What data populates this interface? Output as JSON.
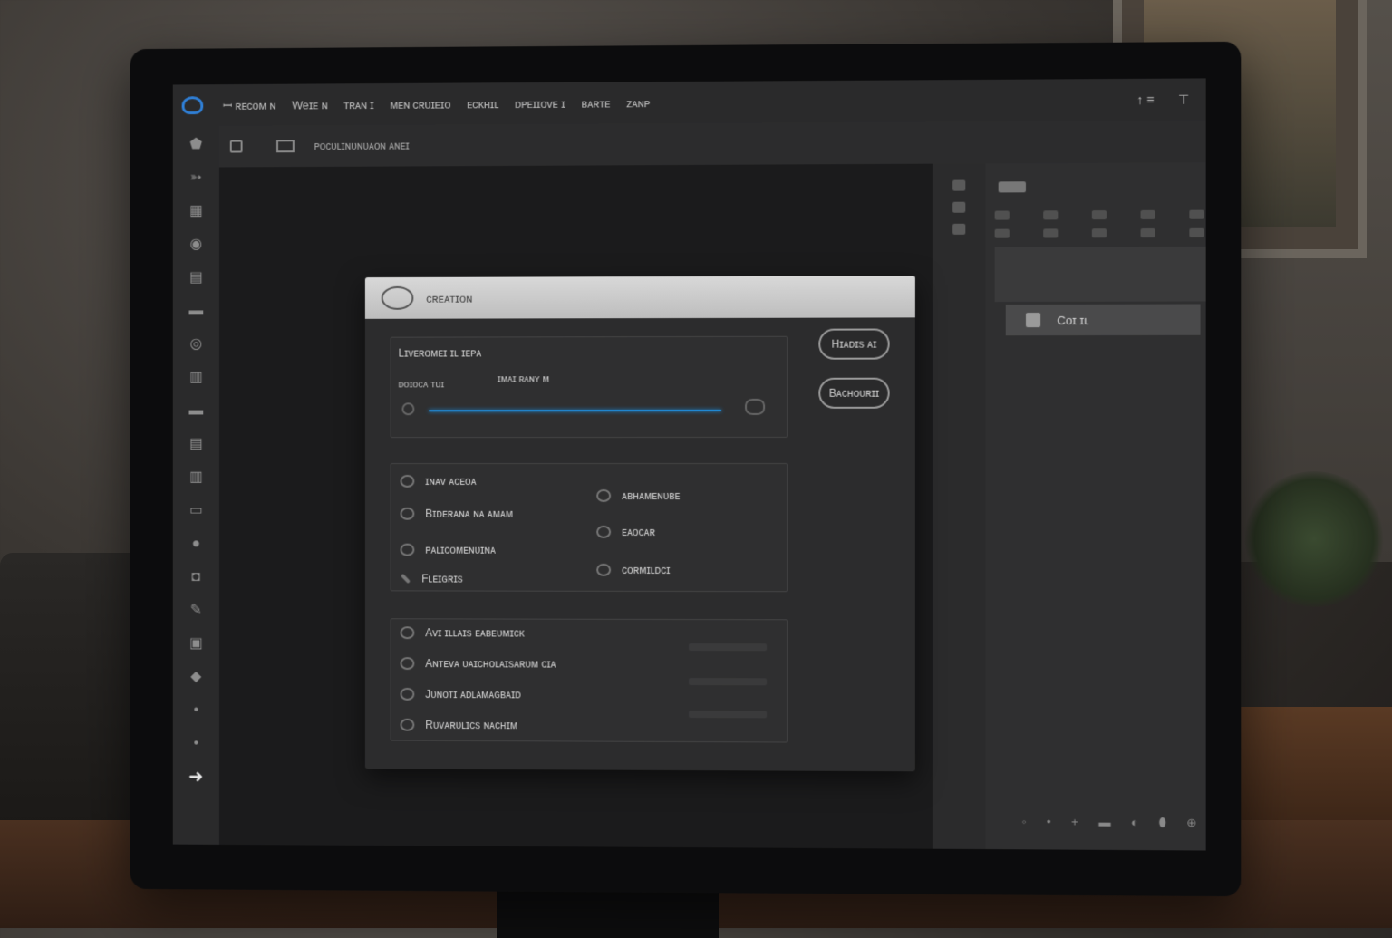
{
  "menubar": {
    "items": [
      "ꟷ ʀᴇᴄᴏᴍ ɴ",
      "Weɪᴇ ɴ",
      "ᴛʀᴀɴ ɪ",
      "ᴍᴇɴ ᴄʀᴜɪᴇɪᴏ",
      "ᴇᴄᴋʜɪʟ",
      "ᴅᴘᴇɪɪᴏᴠᴇ ɪ",
      "ʙᴀʀᴛᴇ",
      "ᴢᴀɴᴘ"
    ],
    "window_controls": [
      "↑ ≡",
      "⊤"
    ]
  },
  "options_bar": {
    "text": "ᴘᴏᴄᴜʟɪɴᴜɴᴜᴀᴏɴ ᴀɴᴇɪ"
  },
  "dialog": {
    "title": "ᴄʀᴇᴀᴛɪᴏɴ",
    "group1": {
      "heading": "Lɪᴠᴇʀᴏᴍᴇɪ  ɪʟ   ɪᴇᴘᴀ",
      "field_label": "ᴅᴏɪᴏᴄᴀ ᴛᴜɪ",
      "field_value": "ɪᴍᴀɪ ʀᴀɴʏ ᴍ"
    },
    "group2": {
      "heading": "ɪɴᴀᴠ ᴀᴄᴇᴏᴀ",
      "options": [
        "Bɪᴅᴇʀᴀɴᴀ ɴᴀ ᴀᴍᴀᴍ",
        "ᴘᴀʟɪᴄᴏᴍᴇɴᴜɪɴᴀ",
        "Fʟᴇɪɢʀɪs",
        "ᴀʙʜᴀᴍᴇɴᴜʙᴇ",
        "ᴇᴀᴏᴄᴀʀ",
        "ᴄᴏʀᴍɪʟᴅᴄɪ"
      ]
    },
    "group3": {
      "options": [
        "Aᴠɪ ɪʟʟᴀɪs ᴇᴀʙᴇᴜᴍɪᴄᴋ",
        "Aɴᴛᴇᴠᴀ ᴜᴀɪᴄʜᴏʟᴀɪsᴀʀᴜᴍ ᴄɪᴀ",
        "Jᴜɴᴏᴛɪ ᴀᴅʟᴀᴍᴀɢʙᴀɪᴅ",
        "Rᴜᴠᴀʀᴜʟɪᴄs ɴᴀᴄʜɪᴍ"
      ]
    },
    "buttons": {
      "ok": "Hɪᴀᴅɪs ᴀɪ",
      "cancel": "Bᴀᴄʜᴏᴜʀɪɪ"
    }
  },
  "layers_panel": {
    "layer_name": "Cᴏɪ ɪʟ",
    "footer_icons": [
      "◦",
      "•",
      "+",
      "▬",
      "◐",
      "⬮",
      "⊕"
    ]
  },
  "colors": {
    "accent": "#1f8fe0",
    "logo": "#2f7fd6",
    "dialog_bg": "#2c2c2d"
  }
}
